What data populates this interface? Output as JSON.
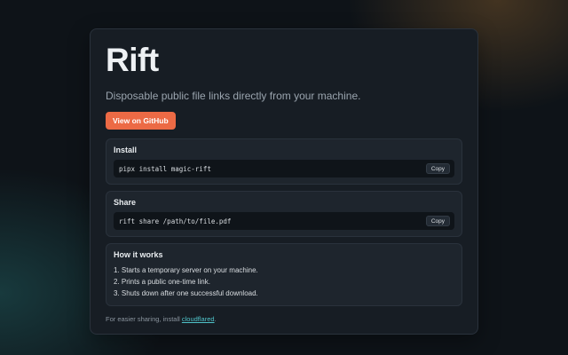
{
  "app": {
    "title": "Rift",
    "subtitle": "Disposable public file links directly from your machine.",
    "github_button_label": "View on GitHub"
  },
  "sections": {
    "install": {
      "title": "Install",
      "command": "pipx install magic-rift",
      "copy_label": "Copy"
    },
    "share": {
      "title": "Share",
      "command": "rift share /path/to/file.pdf",
      "copy_label": "Copy"
    },
    "how": {
      "title": "How it works",
      "steps": [
        "1. Starts a temporary server on your machine.",
        "2. Prints a public one-time link.",
        "3. Shuts down after one successful download."
      ]
    }
  },
  "footer": {
    "text_prefix": "For easier sharing, install ",
    "link_text": "cloudflared",
    "text_suffix": "."
  },
  "colors": {
    "accent": "#ec6a45",
    "link": "#4fc3c9",
    "card_bg": "#171d24",
    "page_bg": "#0e1318"
  }
}
